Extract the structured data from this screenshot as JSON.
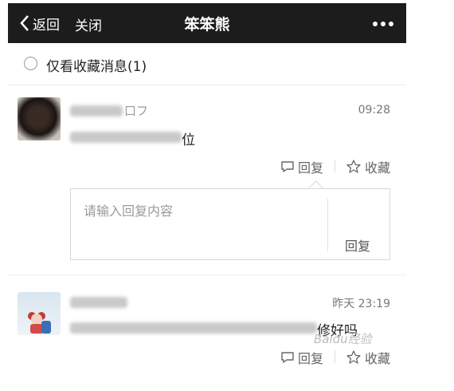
{
  "header": {
    "back_label": "返回",
    "close_label": "关闭",
    "title": "笨笨熊"
  },
  "filter": {
    "label": "仅看收藏消息(1)"
  },
  "messages": [
    {
      "name_visible": "口フ",
      "time": "09:28",
      "text_visible": "位",
      "reply_label": "回复",
      "favorite_label": "收藏"
    },
    {
      "time": "昨天 23:19",
      "text_visible": "修好吗",
      "reply_label": "回复",
      "favorite_label": "收藏"
    }
  ],
  "reply_box": {
    "placeholder": "请输入回复内容",
    "send_label": "回复"
  },
  "watermark": "Baidu经验",
  "colors": {
    "header_bg": "#1c1c1c",
    "divider": "#ececec"
  }
}
